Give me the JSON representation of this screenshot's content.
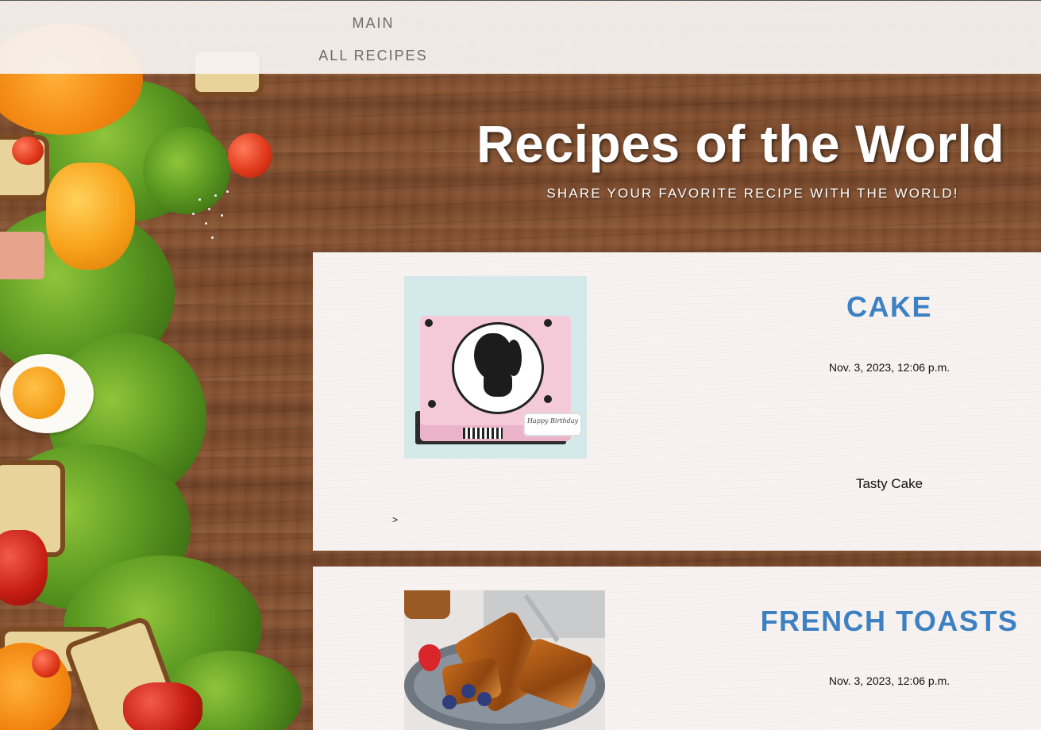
{
  "nav": {
    "items": [
      {
        "label": "MAIN"
      },
      {
        "label": "ALL RECIPES"
      }
    ]
  },
  "hero": {
    "title": "Recipes of the World",
    "subtitle": "SHARE YOUR FAVORITE RECIPE WITH THE WORLD!"
  },
  "recipes": [
    {
      "title": "CAKE",
      "date": "Nov. 3, 2023, 12:06 p.m.",
      "description": "Tasty Cake",
      "more_link": ">",
      "image_text": "Happy Birthday"
    },
    {
      "title": "FRENCH TOASTS",
      "date": "Nov. 3, 2023, 12:06 p.m."
    }
  ],
  "colors": {
    "title_blue": "#3d81c3",
    "card_background": "#f7f2ef",
    "nav_text": "#6b6b6b"
  }
}
